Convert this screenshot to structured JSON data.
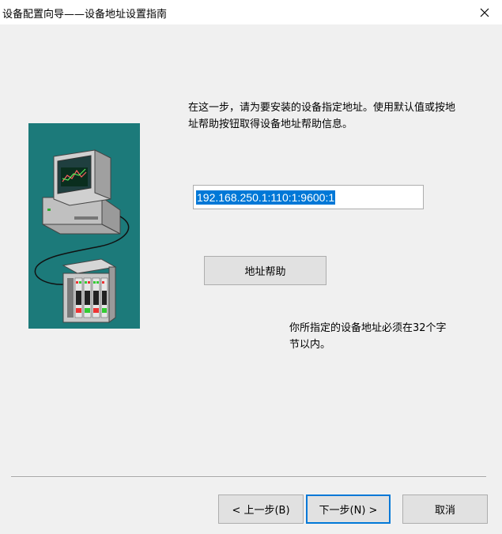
{
  "window": {
    "title": "设备配置向导——设备地址设置指南",
    "close_icon": "close-icon"
  },
  "illustration": {
    "icon": "computer-to-plc-connection-illustration",
    "background": "#1c7a7a"
  },
  "main": {
    "description": "在这一步，请为要安装的设备指定地址。使用默认值或按地址帮助按钮取得设备地址帮助信息。",
    "address_value": "192.168.250.1:110:1:9600:1",
    "help_button_label": "地址帮助",
    "note": "你所指定的设备地址必须在32个字节以内。"
  },
  "footer": {
    "back_label": "< 上一步(B)",
    "next_label": "下一步(N) >",
    "cancel_label": "取消"
  },
  "colors": {
    "selection": "#0078d7",
    "dialog_bg": "#f0f0f0"
  }
}
